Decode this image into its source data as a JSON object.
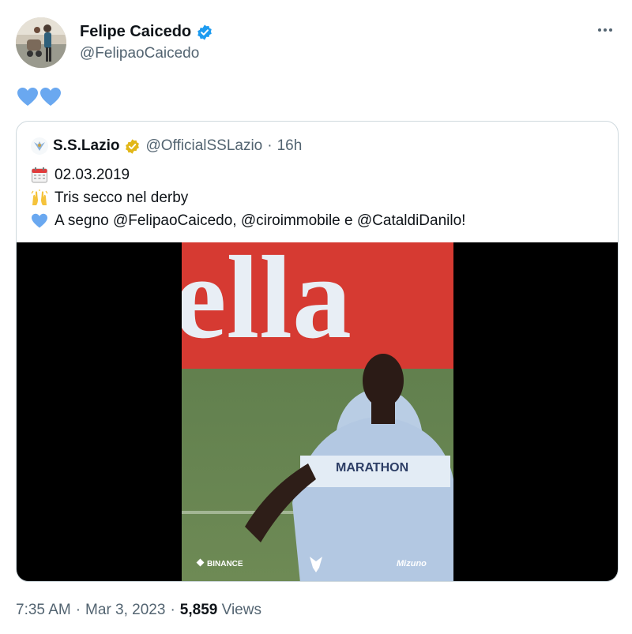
{
  "author": {
    "display_name": "Felipe Caicedo",
    "handle": "@FelipaoCaicedo",
    "verified_icon": "blue-check-icon",
    "avatar_icon": "avatar-photo"
  },
  "tweet": {
    "emoji_icons": [
      "blue-heart-icon",
      "blue-heart-icon"
    ]
  },
  "quoted": {
    "display_name": "S.S.Lazio",
    "handle": "@OfficialSSLazio",
    "separator": "·",
    "time": "16h",
    "verified_icon": "gold-check-icon",
    "lines": [
      {
        "icon": "calendar-icon",
        "text": "02.03.2019"
      },
      {
        "icon": "raised-hands-icon",
        "text": "Tris secco nel derby"
      },
      {
        "icon": "blue-heart-icon",
        "text": "A segno @FelipaoCaicedo, @ciroimmobile e @CataldiDanilo!"
      }
    ],
    "media": {
      "sponsor_left": "BINANCE",
      "sponsor_right": "Mizuno",
      "banner_text": "ella"
    }
  },
  "footer": {
    "time": "7:35 AM",
    "sep1": "·",
    "date": "Mar 3, 2023",
    "sep2": "·",
    "views_count": "5,859",
    "views_label": "Views"
  },
  "colors": {
    "text": "#0f1419",
    "secondary": "#536471",
    "verified_blue": "#1d9bf0",
    "verified_gold": "#e2b719",
    "heart_blue": "#6aa8f0",
    "border": "#cfd9de"
  }
}
